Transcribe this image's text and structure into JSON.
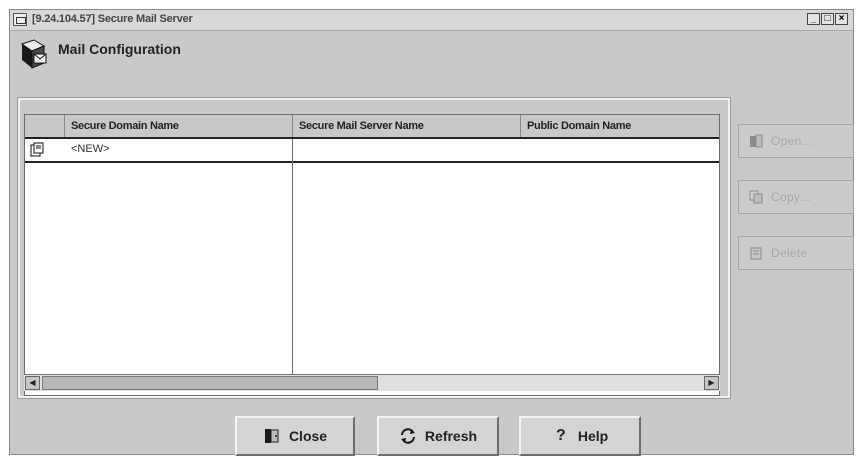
{
  "window": {
    "title": "[9.24.104.57] Secure Mail Server",
    "controls": {
      "minimize": "_",
      "maximize": "□",
      "close": "×"
    }
  },
  "header": {
    "icon": "mail-server-icon",
    "title": "Mail Configuration"
  },
  "table": {
    "columns": [
      "",
      "Secure Domain Name",
      "Secure Mail Server Name",
      "Public Domain Name"
    ],
    "rows": [
      {
        "icon": "new-document-icon",
        "secure_domain_name": "<NEW>",
        "secure_mail_server_name": "",
        "public_domain_name": ""
      }
    ]
  },
  "side_buttons": [
    {
      "label": "Open...",
      "icon": "open-icon",
      "enabled": false
    },
    {
      "label": "Copy...",
      "icon": "copy-icon",
      "enabled": false
    },
    {
      "label": "Delete",
      "icon": "delete-icon",
      "enabled": false
    }
  ],
  "bottom_buttons": [
    {
      "label": "Close",
      "icon": "close-door-icon"
    },
    {
      "label": "Refresh",
      "icon": "refresh-icon"
    },
    {
      "label": "Help",
      "icon": "help-icon"
    }
  ]
}
